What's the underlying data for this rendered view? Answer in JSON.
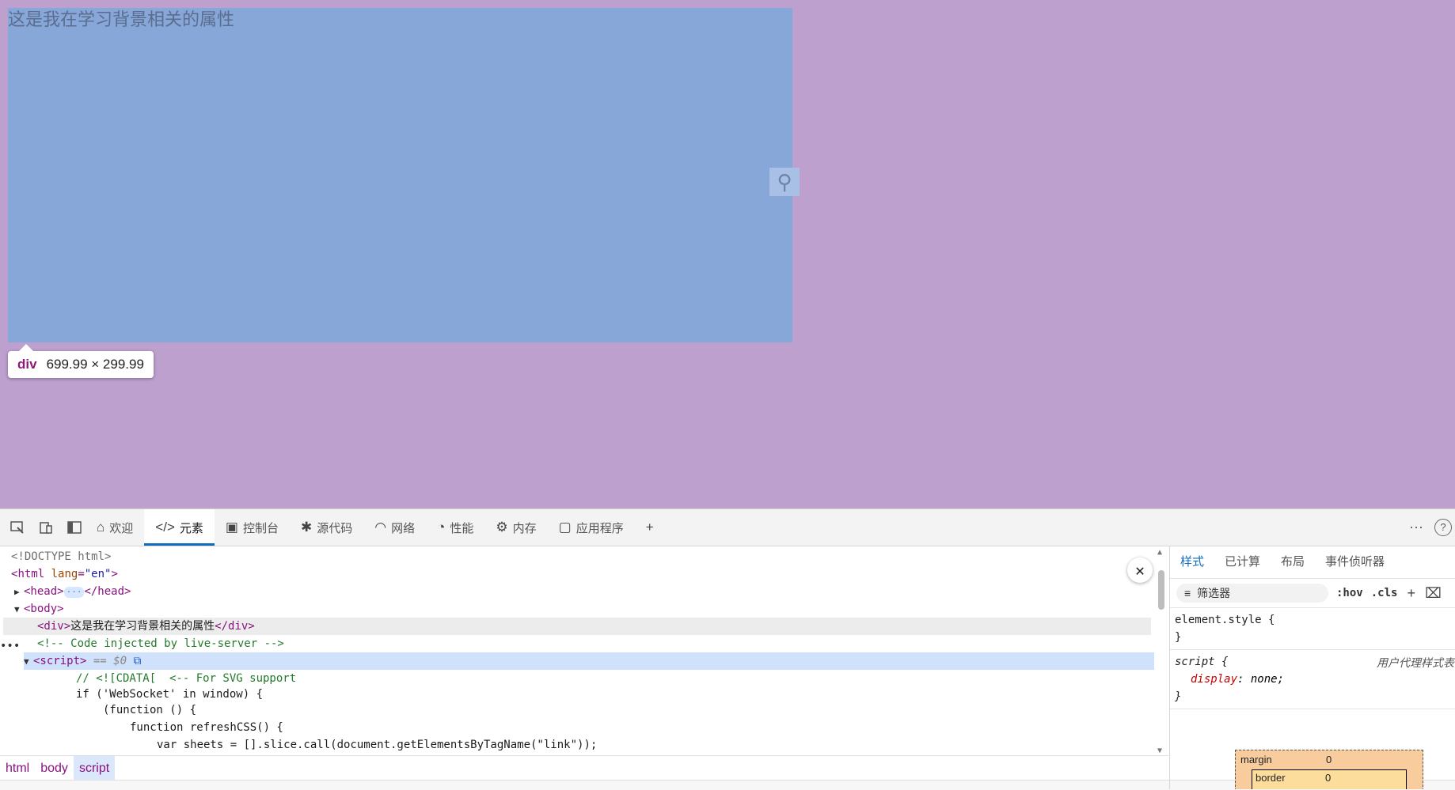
{
  "page": {
    "div_text": "这是我在学习背景相关的属性",
    "tooltip": {
      "tag": "div",
      "size": "699.99 × 299.99"
    },
    "colors": {
      "page_bg": "#bda0ce",
      "div_bg": "#87a7d8",
      "highlight": "#cfe1fb"
    }
  },
  "devtools": {
    "tabs": [
      {
        "label": "欢迎",
        "icon": "home-icon"
      },
      {
        "label": "元素",
        "icon": "code-icon"
      },
      {
        "label": "控制台",
        "icon": "console-icon"
      },
      {
        "label": "源代码",
        "icon": "bug-icon"
      },
      {
        "label": "网络",
        "icon": "wifi-icon"
      },
      {
        "label": "性能",
        "icon": "gauge-icon"
      },
      {
        "label": "内存",
        "icon": "chip-icon"
      },
      {
        "label": "应用程序",
        "icon": "app-icon"
      }
    ],
    "active_tab": "元素",
    "tree": {
      "doctype": "<!DOCTYPE html>",
      "html_open": {
        "tag": "html",
        "attr": "lang",
        "value": "\"en\""
      },
      "head": {
        "open": "<head>",
        "ellipsis": "···",
        "close": "</head>"
      },
      "body_open": "<body>",
      "div": {
        "open": "<div>",
        "text": "这是我在学习背景相关的属性",
        "close": "</div>"
      },
      "comment": "<!-- Code injected by live-server -->",
      "script": {
        "open": "<script>",
        "marker": " == $0"
      },
      "code": [
        "// <![CDATA[  <-- For SVG support",
        "if ('WebSocket' in window) {",
        "(function () {",
        "function refreshCSS() {",
        "var sheets = [].slice.call(document.getElementsByTagName(\"link\"));"
      ]
    },
    "breadcrumb": [
      "html",
      "body",
      "script"
    ],
    "styles": {
      "tabs": [
        "样式",
        "已计算",
        "布局",
        "事件侦听器"
      ],
      "filter_placeholder": "筛选器",
      "hov": ":hov",
      "cls": ".cls",
      "rules": [
        {
          "selector": "element.style {",
          "close": "}"
        },
        {
          "selector": "script {",
          "origin": "用户代理样式表",
          "prop": "display",
          "value": "none;",
          "close": "}"
        }
      ],
      "box_model": {
        "margin_label": "margin",
        "margin_value": "0",
        "border_label": "border",
        "border_value": "0"
      }
    }
  }
}
